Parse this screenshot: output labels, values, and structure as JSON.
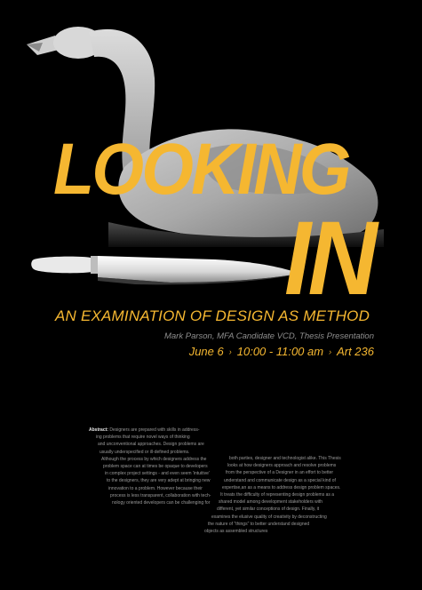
{
  "colors": {
    "background": "#000000",
    "accent": "#f5b731",
    "text_light": "#e8e8e8",
    "text_gray": "#9a9a9a"
  },
  "images": {
    "swan": "swan-photo",
    "knife": "knife-photo"
  },
  "title": {
    "line1": "LOOKING",
    "line2": "IN"
  },
  "subtitle": "AN EXAMINATION OF DESIGN AS METHOD",
  "presenter": "Mark Parson, MFA Candidate VCD, Thesis Presentation",
  "event": {
    "date": "June 6",
    "time": "10:00 - 11:00 am",
    "room": "Art 236",
    "separator": "›"
  },
  "abstract": {
    "label": "Abstract:",
    "column1": [
      " Designers are prepared with skills in address-",
      "ing problems that require novel ways of thinking",
      "and unconventional approaches. Design problems are",
      "usually underspecified or ill-defined problems.",
      "Although the process by which designers address the",
      "problem space can at times be opaque to developers",
      "in complex project settings - and even seem 'intuitive'",
      "to the designers, they are very adept at bringing new",
      "innovation to a problem. However because their",
      "process is less transparent, collaboration with tech-",
      "nology oriented developers can be challenging for"
    ],
    "column2": [
      "both parties, designer and technologist alike. This Thesis",
      "looks at how designers approach and resolve problems",
      "from the perspective of a Designer in an effort to better",
      "understand and communicate design as a special kind of",
      "expertise,an as a means to address design problem spaces.",
      "It treats the difficulty of representing design problems as a",
      "shared model among development stakeholders with",
      "different, yet similar conceptions of design. Finally, it",
      "examines the elusive quality of creativity by deconstructing",
      "the nature of \"things\" to better understand designed",
      "objects as assembled structures"
    ]
  }
}
